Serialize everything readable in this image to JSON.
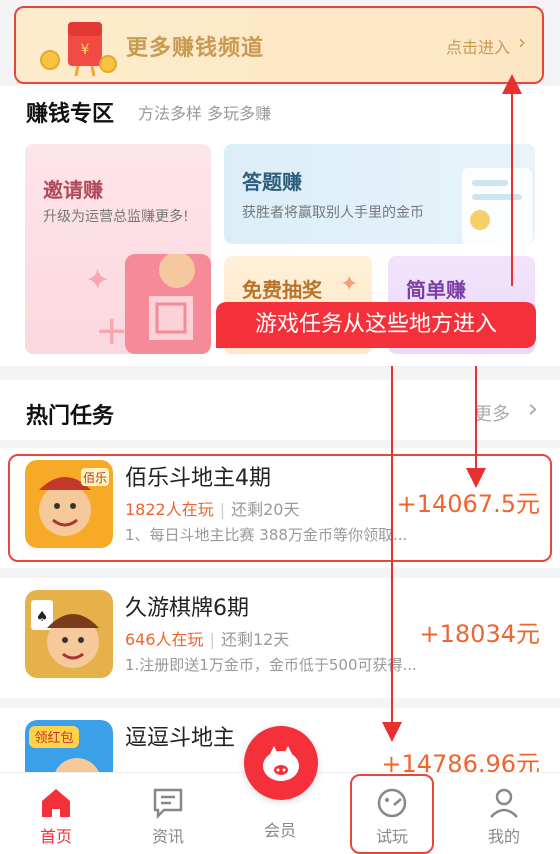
{
  "banner": {
    "title": "更多赚钱频道",
    "enter": "点击进入"
  },
  "zone": {
    "title": "赚钱专区",
    "subtitle": "方法多样 多玩多赚",
    "cards": [
      {
        "title": "邀请赚",
        "desc": "升级为运营总监赚更多!"
      },
      {
        "title": "答题赚",
        "desc": "获胜者将赢取别人手里的金币"
      },
      {
        "title": "免费抽奖"
      },
      {
        "title": "简单赚"
      }
    ]
  },
  "callout": "游戏任务从这些地方进入",
  "hot": {
    "title": "热门任务",
    "more": "更多"
  },
  "tasks": [
    {
      "name": "佰乐斗地主4期",
      "players": "1822人在玩",
      "remaining": "还剩20天",
      "desc": "1、每日斗地主比赛 388万金币等你领取...",
      "reward": "+14067.5元",
      "icon_text": "佰乐"
    },
    {
      "name": "久游棋牌6期",
      "players": "646人在玩",
      "remaining": "还剩12天",
      "desc": "1.注册即送1万金币，金币低于500可获得...",
      "reward": "+18034元"
    },
    {
      "name": "逗逗斗地主",
      "players": "",
      "remaining": "",
      "desc": "",
      "reward": "+14786.96元",
      "icon_text": "领红包"
    }
  ],
  "tabs": [
    {
      "label": "首页",
      "icon": "home-icon"
    },
    {
      "label": "资讯",
      "icon": "news-icon"
    },
    {
      "label": "会员",
      "icon": "pig-icon"
    },
    {
      "label": "试玩",
      "icon": "gamepad-icon"
    },
    {
      "label": "我的",
      "icon": "user-icon"
    }
  ],
  "colors": {
    "accent": "#f4313a",
    "reward": "#f0642d",
    "banner_text": "#c99a52"
  }
}
